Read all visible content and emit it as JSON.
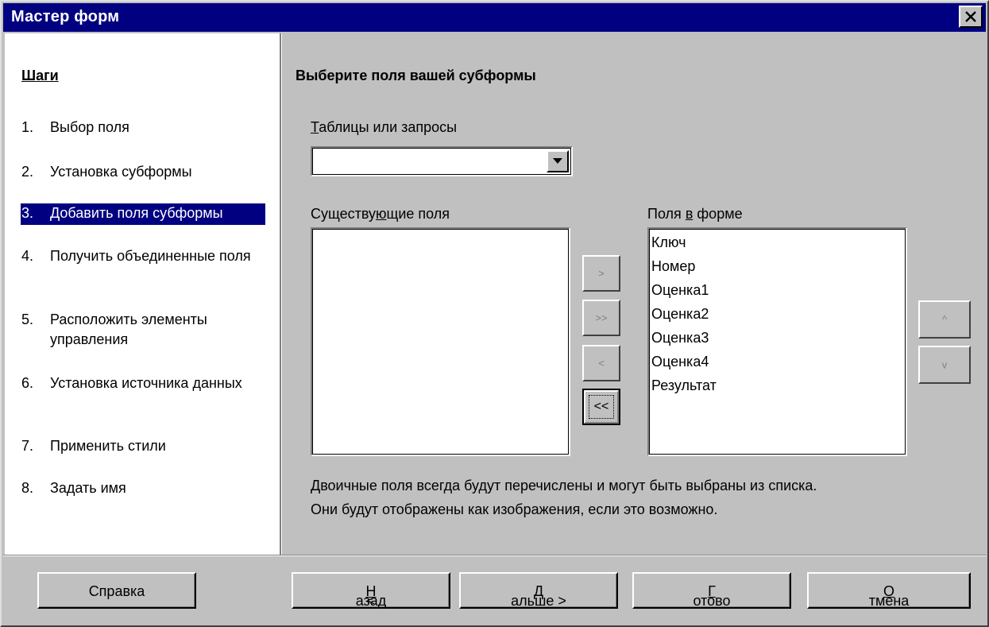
{
  "window": {
    "title": "Мастер форм"
  },
  "steps": {
    "heading": "Шаги",
    "items": [
      {
        "num": "1.",
        "label": "Выбор поля"
      },
      {
        "num": "2.",
        "label": "Установка субформы"
      },
      {
        "num": "3.",
        "label": "Добавить поля субформы",
        "active": true
      },
      {
        "num": "4.",
        "label": "Получить объединенные поля"
      },
      {
        "num": "5.",
        "label": "Расположить элементы управления"
      },
      {
        "num": "6.",
        "label": "Установка источника данных"
      },
      {
        "num": "7.",
        "label": "Применить стили"
      },
      {
        "num": "8.",
        "label": "Задать имя"
      }
    ]
  },
  "main": {
    "heading": "Выберите поля вашей субформы",
    "tables_label_prefix": "",
    "tables_label_accel": "Т",
    "tables_label_rest": "аблицы или запросы",
    "tables_value": "",
    "existing_label_a": "Существу",
    "existing_label_accel": "ю",
    "existing_label_b": "щие поля",
    "infields_label_a": "Поля ",
    "infields_label_accel": "в",
    "infields_label_b": " форме",
    "existing_fields": [],
    "form_fields": [
      "Ключ",
      "Номер",
      "Оценка1",
      "Оценка2",
      "Оценка3",
      "Оценка4",
      "Результат"
    ],
    "move_buttons": {
      "add": ">",
      "add_all": ">>",
      "remove": "<",
      "remove_all": "<<"
    },
    "order_buttons": {
      "up": "^",
      "down": "v"
    },
    "info_line1": "Двоичные поля всегда будут перечислены и могут быть выбраны из списка.",
    "info_line2": "Они будут отображены как изображения, если это возможно."
  },
  "buttons": {
    "help": "Справка",
    "back_prefix": "< ",
    "back_accel": "Н",
    "back_rest": "азад",
    "next_accel": "Д",
    "next_rest": "альше >",
    "finish_accel": "Г",
    "finish_rest": "отово",
    "cancel_accel": "О",
    "cancel_rest": "тмена"
  }
}
